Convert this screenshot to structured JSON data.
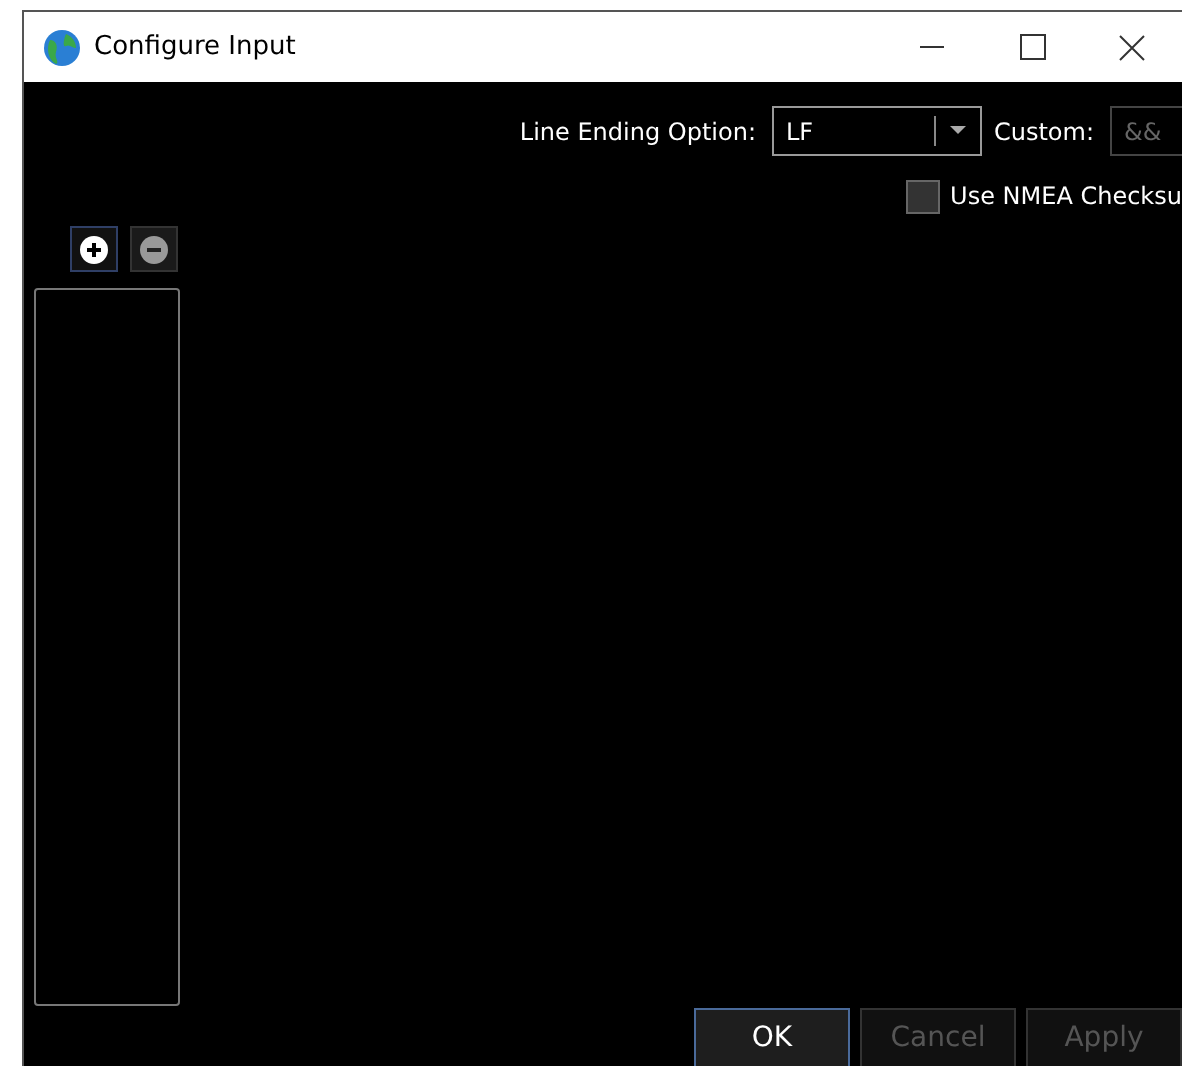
{
  "window": {
    "title": "Configure Input"
  },
  "line_ending": {
    "label": "Line Ending Option:",
    "value": "LF"
  },
  "custom": {
    "label": "Custom:",
    "value": "&&",
    "disabled": true
  },
  "nmea_checksum": {
    "label": "Use NMEA Checksu",
    "checked": false
  },
  "list_tools": [
    {
      "kind": "add",
      "disabled": false
    },
    {
      "kind": "remove",
      "disabled": true
    }
  ],
  "buttons": [
    {
      "label": "OK",
      "disabled": false,
      "selected": true
    },
    {
      "label": "Cancel",
      "disabled": true,
      "selected": false
    },
    {
      "label": "Apply",
      "disabled": true,
      "selected": false
    }
  ]
}
